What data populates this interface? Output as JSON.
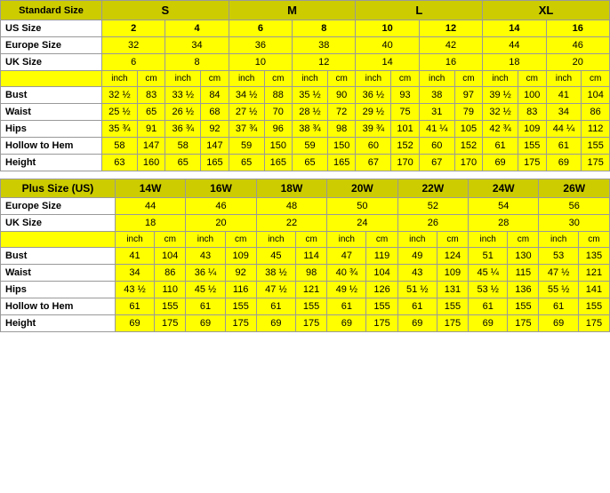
{
  "standardTable": {
    "title": "Standard Size",
    "sizeGroups": [
      "S",
      "M",
      "L",
      "XL"
    ],
    "sizeGroupSpans": [
      4,
      4,
      4,
      4
    ],
    "usSize": [
      "2",
      "4",
      "6",
      "8",
      "10",
      "12",
      "14",
      "16"
    ],
    "europeSize": [
      "32",
      "34",
      "36",
      "38",
      "40",
      "42",
      "44",
      "46"
    ],
    "ukSize": [
      "6",
      "8",
      "10",
      "12",
      "14",
      "16",
      "18",
      "20"
    ],
    "units": [
      "inch",
      "cm",
      "inch",
      "cm",
      "inch",
      "cm",
      "inch",
      "cm",
      "inch",
      "cm",
      "inch",
      "cm",
      "inch",
      "cm",
      "inch",
      "cm"
    ],
    "rows": [
      {
        "label": "Bust",
        "values": [
          "32 ½",
          "83",
          "33 ½",
          "84",
          "34 ½",
          "88",
          "35 ½",
          "90",
          "36 ½",
          "93",
          "38",
          "97",
          "39 ½",
          "100",
          "41",
          "104"
        ]
      },
      {
        "label": "Waist",
        "values": [
          "25 ½",
          "65",
          "26 ½",
          "68",
          "27 ½",
          "70",
          "28 ½",
          "72",
          "29 ½",
          "75",
          "31",
          "79",
          "32 ½",
          "83",
          "34",
          "86"
        ]
      },
      {
        "label": "Hips",
        "values": [
          "35 ¾",
          "91",
          "36 ¾",
          "92",
          "37 ¾",
          "96",
          "38 ¾",
          "98",
          "39 ¾",
          "101",
          "41 ¼",
          "105",
          "42 ¾",
          "109",
          "44 ¼",
          "112"
        ]
      },
      {
        "label": "Hollow to Hem",
        "values": [
          "58",
          "147",
          "58",
          "147",
          "59",
          "150",
          "59",
          "150",
          "60",
          "152",
          "60",
          "152",
          "61",
          "155",
          "61",
          "155"
        ]
      },
      {
        "label": "Height",
        "values": [
          "63",
          "160",
          "65",
          "165",
          "65",
          "165",
          "65",
          "165",
          "67",
          "170",
          "67",
          "170",
          "69",
          "175",
          "69",
          "175"
        ]
      }
    ]
  },
  "plusTable": {
    "title": "Plus Size (US)",
    "sizes": [
      "14W",
      "16W",
      "18W",
      "20W",
      "22W",
      "24W",
      "26W"
    ],
    "europeSize": [
      "44",
      "46",
      "48",
      "50",
      "52",
      "54",
      "56"
    ],
    "ukSize": [
      "18",
      "20",
      "22",
      "24",
      "26",
      "28",
      "30"
    ],
    "units": [
      "inch",
      "cm",
      "inch",
      "cm",
      "inch",
      "cm",
      "inch",
      "cm",
      "inch",
      "cm",
      "inch",
      "cm",
      "inch",
      "cm"
    ],
    "rows": [
      {
        "label": "Bust",
        "values": [
          "41",
          "104",
          "43",
          "109",
          "45",
          "114",
          "47",
          "119",
          "49",
          "124",
          "51",
          "130",
          "53",
          "135"
        ]
      },
      {
        "label": "Waist",
        "values": [
          "34",
          "86",
          "36 ¼",
          "92",
          "38 ½",
          "98",
          "40 ¾",
          "104",
          "43",
          "109",
          "45 ¼",
          "115",
          "47 ½",
          "121"
        ]
      },
      {
        "label": "Hips",
        "values": [
          "43 ½",
          "110",
          "45 ½",
          "116",
          "47 ½",
          "121",
          "49 ½",
          "126",
          "51 ½",
          "131",
          "53 ½",
          "136",
          "55 ½",
          "141"
        ]
      },
      {
        "label": "Hollow to Hem",
        "values": [
          "61",
          "155",
          "61",
          "155",
          "61",
          "155",
          "61",
          "155",
          "61",
          "155",
          "61",
          "155",
          "61",
          "155"
        ]
      },
      {
        "label": "Height",
        "values": [
          "69",
          "175",
          "69",
          "175",
          "69",
          "175",
          "69",
          "175",
          "69",
          "175",
          "69",
          "175",
          "69",
          "175"
        ]
      }
    ]
  }
}
